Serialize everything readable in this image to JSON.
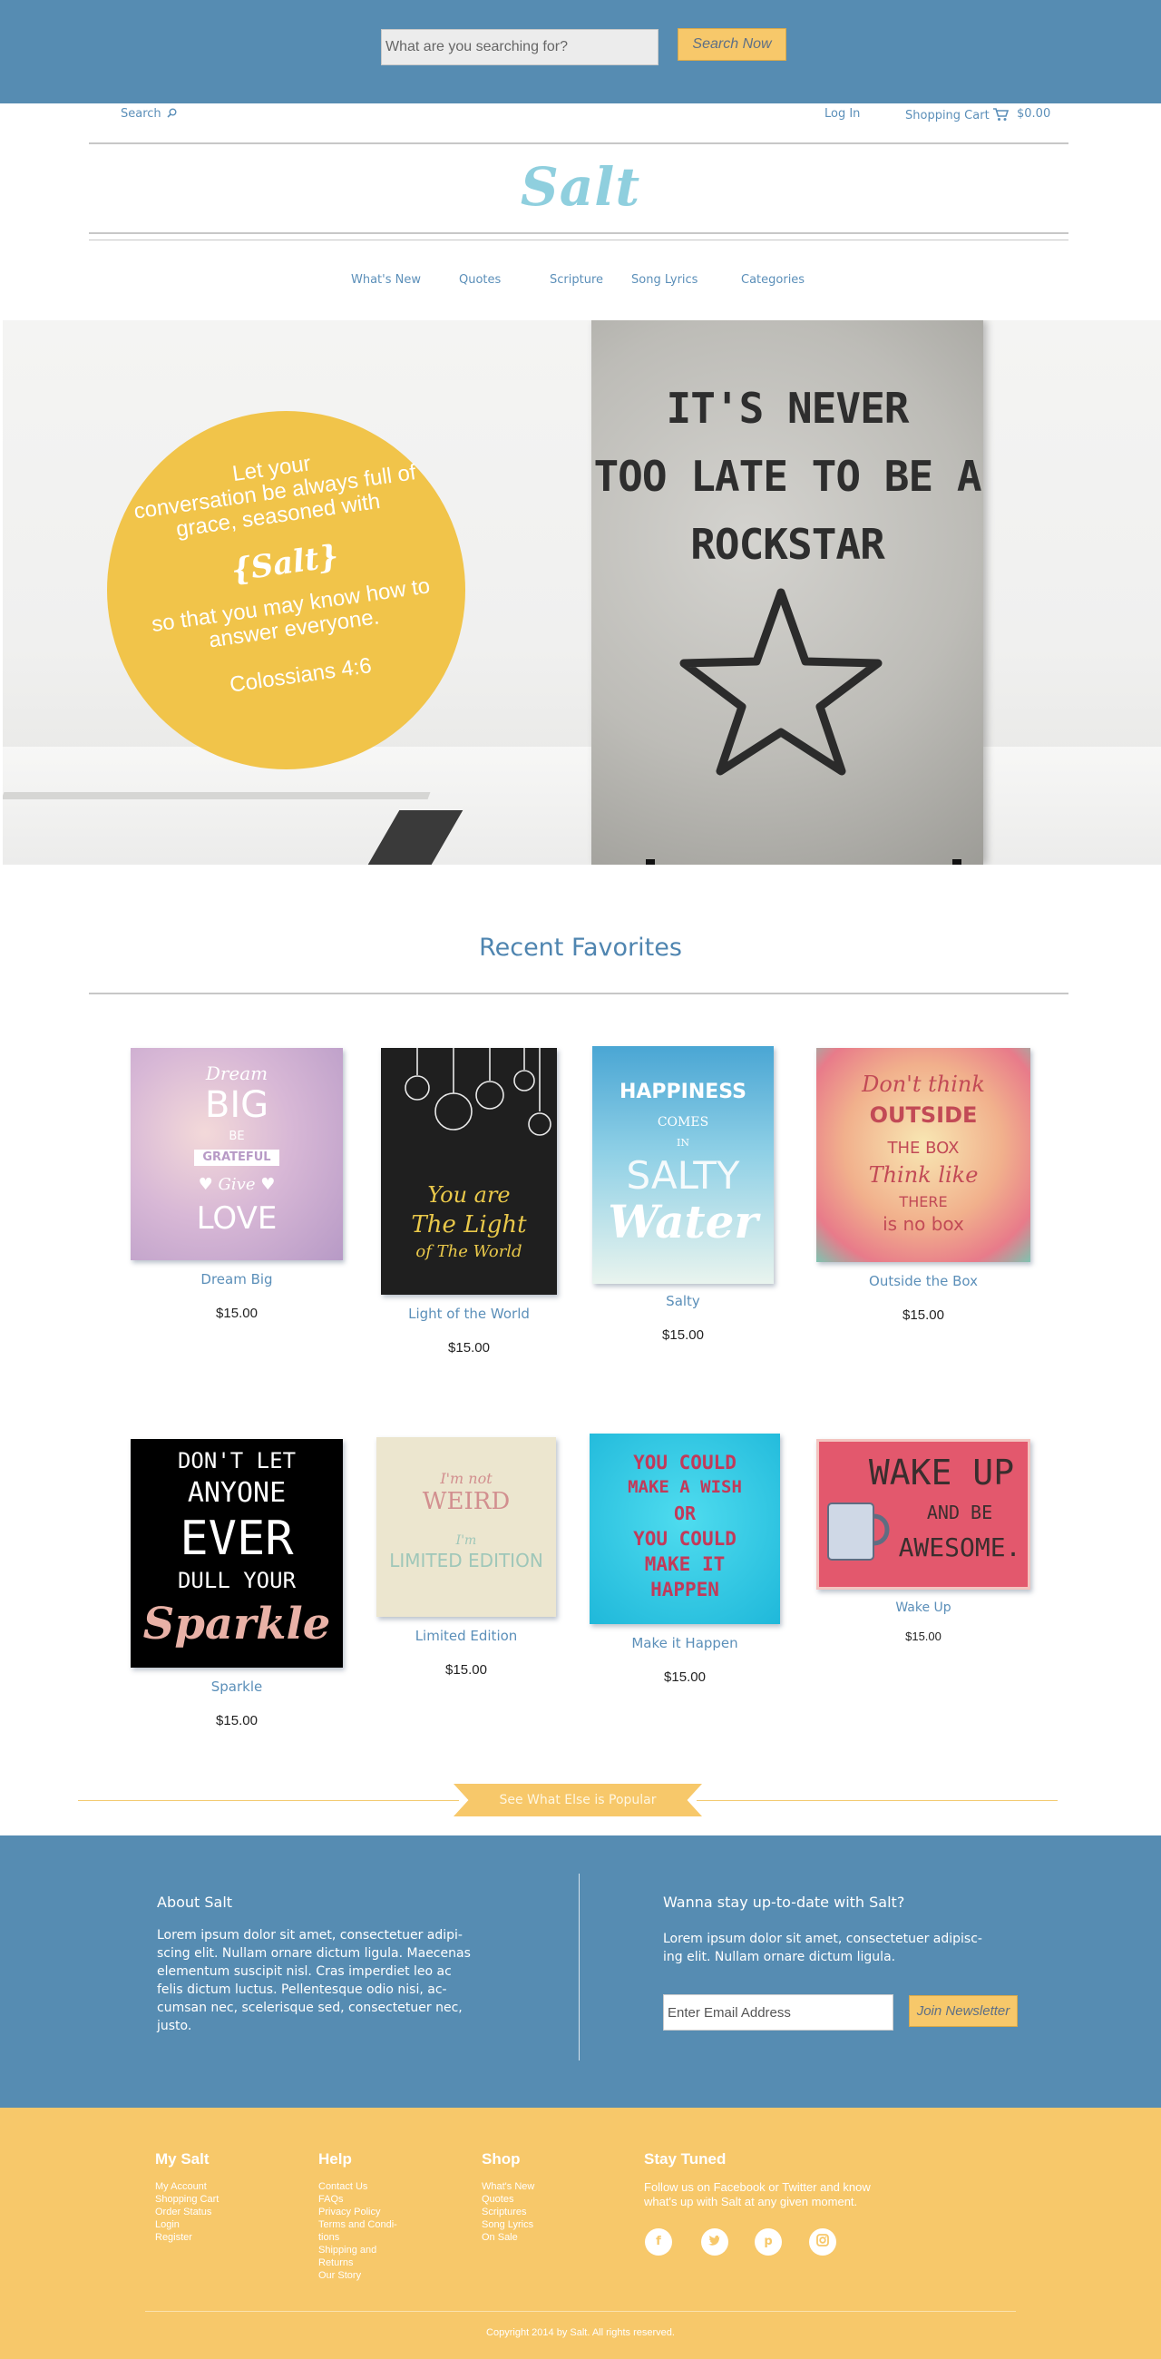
{
  "search": {
    "placeholder": "What are you searching for?",
    "button_label": "Search Now"
  },
  "util_nav": {
    "search_label": "Search",
    "login_label": "Log In",
    "cart_label": "Shopping Cart",
    "cart_total": "$0.00"
  },
  "brand": {
    "logo": "Salt"
  },
  "main_nav": {
    "items": [
      "What's New",
      "Quotes",
      "Scripture",
      "Song Lyrics",
      "Categories"
    ]
  },
  "hero": {
    "verse_lines": [
      "Let your",
      "conversation be always full of",
      "grace, seasoned with"
    ],
    "salt_mark": "{Salt}",
    "verse_rest_lines": [
      "so that you may know how to",
      "answer everyone."
    ],
    "reference": "Colossians 4:6",
    "poster_lines": [
      "IT'S NEVER",
      "TOO LATE TO BE A",
      "ROCKSTAR"
    ]
  },
  "recent_favorites": {
    "title": "Recent Favorites",
    "products": [
      {
        "name": "Dream Big",
        "price": "$15.00",
        "art_lines": [
          "Dream",
          "BIG",
          "BE",
          "GRATEFUL",
          "♥ Give ♥",
          "LOVE"
        ]
      },
      {
        "name": "Light of the World",
        "price": "$15.00",
        "art_lines": [
          "You are",
          "The Light",
          "of The World"
        ]
      },
      {
        "name": "Salty",
        "price": "$15.00",
        "art_lines": [
          "HAPPINESS",
          "COMES",
          "IN",
          "SALTY",
          "Water"
        ]
      },
      {
        "name": "Outside the Box",
        "price": "$15.00",
        "art_lines": [
          "Don't think",
          "OUTSIDE",
          "THE BOX",
          "Think like",
          "THERE",
          "is no box"
        ]
      },
      {
        "name": "Sparkle",
        "price": "$15.00",
        "art_lines": [
          "DON'T LET",
          "ANYONE",
          "EVER",
          "DULL YOUR",
          "Sparkle"
        ]
      },
      {
        "name": "Limited Edition",
        "price": "$15.00",
        "art_lines": [
          "I'm not",
          "WEIRD",
          "I'm",
          "LIMITED EDITION"
        ]
      },
      {
        "name": "Make it Happen",
        "price": "$15.00",
        "art_lines": [
          "YOU COULD",
          "MAKE A WISH",
          "OR",
          "YOU COULD",
          "MAKE IT",
          "HAPPEN"
        ]
      },
      {
        "name": "Wake Up",
        "price": "$15.00",
        "art_lines": [
          "WAKE UP",
          "AND BE",
          "AWESOME."
        ]
      }
    ]
  },
  "popular": {
    "label": "See What Else is Popular"
  },
  "about": {
    "title": "About Salt",
    "body_lines": [
      "Lorem ipsum dolor sit amet, consectetuer adipi-",
      "scing elit. Nullam ornare dictum ligula. Maecenas",
      "elementum suscipit nisl. Cras imperdiet leo ac",
      "felis dictum luctus. Pellentesque odio nisi, ac-",
      "cumsan nec, scelerisque sed, consectetuer nec,",
      "justo."
    ]
  },
  "newsletter": {
    "title": "Wanna stay up-to-date with Salt?",
    "body_lines": [
      "Lorem ipsum dolor sit amet, consectetuer adipisc-",
      "ing elit. Nullam ornare dictum ligula."
    ],
    "email_placeholder": "Enter Email Address",
    "button_label": "Join Newsletter"
  },
  "footer": {
    "columns": [
      {
        "title": "My Salt",
        "links": [
          "My Account",
          "Shopping Cart",
          "Order Status",
          "Login",
          "Register"
        ]
      },
      {
        "title": "Help",
        "links": [
          "Contact Us",
          "FAQs",
          "Privacy Policy",
          "Terms and Condi-",
          "tions",
          "Shipping and",
          "Returns",
          "Our Story"
        ]
      },
      {
        "title": "Shop",
        "links": [
          "What's New",
          "Quotes",
          "Scriptures",
          "Song Lyrics",
          "On Sale"
        ]
      }
    ],
    "stay_tuned": {
      "title": "Stay Tuned",
      "body_lines": [
        "Follow us on Facebook or Twitter and know",
        "what's up with Salt at any given moment."
      ],
      "social": [
        "facebook-icon",
        "twitter-icon",
        "pinterest-icon",
        "instagram-icon"
      ]
    },
    "copyright": "Copyright 2014 by Salt. All rights reserved."
  },
  "colors": {
    "primary_blue": "#568cb2",
    "accent_yellow": "#f7c86a",
    "logo_blue": "#8fcfde",
    "link_blue": "#5b8fb9",
    "hero_circle": "#f1c44a"
  }
}
